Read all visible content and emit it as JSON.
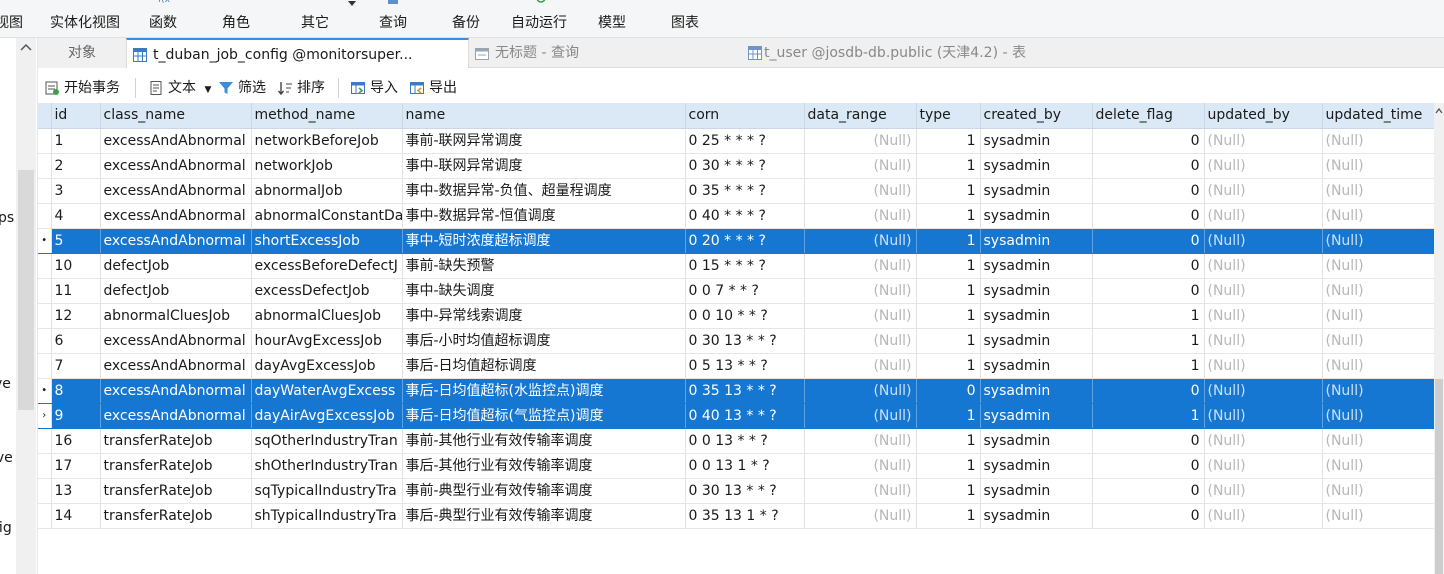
{
  "ribbon": {
    "items": [
      {
        "label": "视图",
        "icon": "view-icon"
      },
      {
        "label": "实体化视图",
        "icon": "materialized-view-icon"
      },
      {
        "label": "函数",
        "icon": "function-icon"
      },
      {
        "label": "角色",
        "icon": "role-icon"
      },
      {
        "label": "其它",
        "icon": "other-icon"
      },
      {
        "label": "查询",
        "icon": "query-icon"
      },
      {
        "label": "备份",
        "icon": "backup-icon"
      },
      {
        "label": "自动运行",
        "icon": "autorun-icon"
      },
      {
        "label": "模型",
        "icon": "model-icon"
      },
      {
        "label": "图表",
        "icon": "chart-icon"
      }
    ]
  },
  "sidebar": {
    "fragments": [
      "ps",
      "ve",
      "ive",
      "fig"
    ]
  },
  "tabs": {
    "objects": "对象",
    "active": "t_duban_job_config @monitorsuper...",
    "query": "无标题 - 查询",
    "tuser": "t_user @josdb-db.public (天津4.2) - 表"
  },
  "toolbar": {
    "begin_transaction": "开始事务",
    "text": "文本",
    "filter": "筛选",
    "sort": "排序",
    "import": "导入",
    "export": "导出"
  },
  "colors": {
    "selection": "#1677d2",
    "header": "#dbe9f7",
    "null_text": "#b7b7b7",
    "accent": "#3c8dde"
  },
  "grid": {
    "columns": [
      "id",
      "class_name",
      "method_name",
      "name",
      "corn",
      "data_range",
      "type",
      "created_by",
      "delete_flag",
      "updated_by",
      "updated_time"
    ],
    "rows": [
      {
        "indicator": "",
        "selected": false,
        "cells": [
          "1",
          "excessAndAbnormal",
          "networkBeforeJob",
          "事前-联网异常调度",
          "0 25 * * * ?",
          "(Null)",
          "1",
          "sysadmin",
          "0",
          "(Null)",
          "(Null)"
        ]
      },
      {
        "indicator": "",
        "selected": false,
        "cells": [
          "2",
          "excessAndAbnormal",
          "networkJob",
          "事中-联网异常调度",
          "0 30 * * * ?",
          "(Null)",
          "1",
          "sysadmin",
          "0",
          "(Null)",
          "(Null)"
        ]
      },
      {
        "indicator": "",
        "selected": false,
        "cells": [
          "3",
          "excessAndAbnormal",
          "abnormalJob",
          "事中-数据异常-负值、超量程调度",
          "0 35 * * * ?",
          "(Null)",
          "1",
          "sysadmin",
          "0",
          "(Null)",
          "(Null)"
        ]
      },
      {
        "indicator": "",
        "selected": false,
        "cells": [
          "4",
          "excessAndAbnormal",
          "abnormalConstantDa",
          "事中-数据异常-恒值调度",
          "0 40 * * * ?",
          "(Null)",
          "1",
          "sysadmin",
          "0",
          "(Null)",
          "(Null)"
        ]
      },
      {
        "indicator": "•",
        "selected": true,
        "cells": [
          "5",
          "excessAndAbnormal",
          "shortExcessJob",
          "事中-短时浓度超标调度",
          "0 20 * * * ?",
          "(Null)",
          "1",
          "sysadmin",
          "0",
          "(Null)",
          "(Null)"
        ]
      },
      {
        "indicator": "",
        "selected": false,
        "cells": [
          "10",
          "defectJob",
          "excessBeforeDefectJ",
          "事前-缺失预警",
          "0 15 * * * ?",
          "(Null)",
          "1",
          "sysadmin",
          "0",
          "(Null)",
          "(Null)"
        ]
      },
      {
        "indicator": "",
        "selected": false,
        "cells": [
          "11",
          "defectJob",
          "excessDefectJob",
          "事中-缺失调度",
          "0 0 7 * * ?",
          "(Null)",
          "1",
          "sysadmin",
          "0",
          "(Null)",
          "(Null)"
        ]
      },
      {
        "indicator": "",
        "selected": false,
        "cells": [
          "12",
          "abnormalCluesJob",
          "abnormalCluesJob",
          "事中-异常线索调度",
          "0 0 10 * * ?",
          "(Null)",
          "1",
          "sysadmin",
          "1",
          "(Null)",
          "(Null)"
        ]
      },
      {
        "indicator": "",
        "selected": false,
        "cells": [
          "6",
          "excessAndAbnormal",
          "hourAvgExcessJob",
          "事后-小时均值超标调度",
          "0 30 13 * * ?",
          "(Null)",
          "1",
          "sysadmin",
          "1",
          "(Null)",
          "(Null)"
        ]
      },
      {
        "indicator": "",
        "selected": false,
        "cells": [
          "7",
          "excessAndAbnormal",
          "dayAvgExcessJob",
          "事后-日均值超标调度",
          "0 5 13 * * ?",
          "(Null)",
          "1",
          "sysadmin",
          "1",
          "(Null)",
          "(Null)"
        ]
      },
      {
        "indicator": "•",
        "selected": true,
        "cells": [
          "8",
          "excessAndAbnormal",
          "dayWaterAvgExcess",
          "事后-日均值超标(水监控点)调度",
          "0 35 13 * * ?",
          "(Null)",
          "0",
          "sysadmin",
          "0",
          "(Null)",
          "(Null)"
        ]
      },
      {
        "indicator": "›",
        "selected": true,
        "cells": [
          "9",
          "excessAndAbnormal",
          "dayAirAvgExcessJob",
          "事后-日均值超标(气监控点)调度",
          "0 40 13 * * ?",
          "(Null)",
          "1",
          "sysadmin",
          "1",
          "(Null)",
          "(Null)"
        ]
      },
      {
        "indicator": "",
        "selected": false,
        "cells": [
          "16",
          "transferRateJob",
          "sqOtherIndustryTran",
          "事前-其他行业有效传输率调度",
          "0 0 13 * * ?",
          "(Null)",
          "1",
          "sysadmin",
          "0",
          "(Null)",
          "(Null)"
        ]
      },
      {
        "indicator": "",
        "selected": false,
        "cells": [
          "17",
          "transferRateJob",
          "shOtherIndustryTran",
          "事后-其他行业有效传输率调度",
          "0 0 13 1 * ?",
          "(Null)",
          "1",
          "sysadmin",
          "0",
          "(Null)",
          "(Null)"
        ]
      },
      {
        "indicator": "",
        "selected": false,
        "cells": [
          "13",
          "transferRateJob",
          "sqTypicalIndustryTra",
          "事前-典型行业有效传输率调度",
          "0 30 13 * * ?",
          "(Null)",
          "1",
          "sysadmin",
          "0",
          "(Null)",
          "(Null)"
        ]
      },
      {
        "indicator": "",
        "selected": false,
        "cells": [
          "14",
          "transferRateJob",
          "shTypicalIndustryTra",
          "事后-典型行业有效传输率调度",
          "0 35 13 1 * ?",
          "(Null)",
          "1",
          "sysadmin",
          "0",
          "(Null)",
          "(Null)"
        ]
      }
    ]
  }
}
